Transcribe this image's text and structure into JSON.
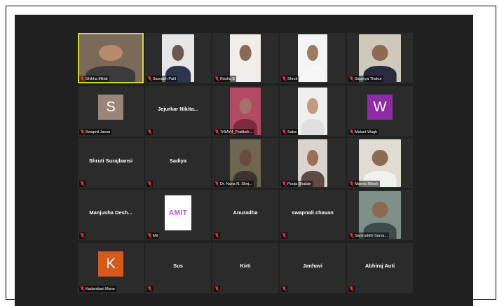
{
  "meeting": {
    "participants": [
      {
        "name": "Shikha Mittal",
        "type": "video",
        "active": true,
        "bg": "#7b6a59",
        "skin": "#b88a6b",
        "cloth": "#3b3b3b"
      },
      {
        "name": "Saurabh Patil",
        "type": "video",
        "bg": "#e6e6e6",
        "skin": "#6b5a4b",
        "cloth": "#2d3550"
      },
      {
        "name": "Rosha B",
        "type": "video",
        "bg": "#f1ede8",
        "skin": "#8a6a55",
        "cloth": "#eeeeee"
      },
      {
        "name": "Shruti",
        "type": "video",
        "bg": "#f4f4f4",
        "skin": "#a07a60",
        "cloth": "#f7f7f7"
      },
      {
        "name": "Saumya Thakur",
        "type": "video",
        "bg": "#cfc9bd",
        "skin": "#8c6b52",
        "cloth": "#2b2b40"
      },
      {
        "name": "Swapnil Jawar",
        "type": "avatar",
        "letter": "S",
        "color": "#9b8579"
      },
      {
        "name": "Jejurkar Nikita...",
        "type": "name"
      },
      {
        "name": "TrBAY4_Pratiksh...",
        "type": "video",
        "bg": "#b34a63",
        "skin": "#a5726a",
        "cloth": "#7b2b3d"
      },
      {
        "name": "Saba",
        "type": "video",
        "bg": "#efefef",
        "skin": "#c29b82",
        "cloth": "#e0e0e0"
      },
      {
        "name": "Malant Wagh",
        "type": "avatar",
        "letter": "W",
        "color": "#8e2ca3"
      },
      {
        "name": "Shruti Surajbansi",
        "type": "name"
      },
      {
        "name": "Sadiya",
        "type": "name"
      },
      {
        "name": "Dr. Nana N. Shej...",
        "type": "video",
        "bg": "#6e6651",
        "skin": "#6a4a3a",
        "cloth": "#3a3430"
      },
      {
        "name": "Pooja Bhalale",
        "type": "video",
        "bg": "#d9d4cd",
        "skin": "#9a7057",
        "cloth": "#5d4c44"
      },
      {
        "name": "Mamta Nilesh",
        "type": "video",
        "bg": "#e1dcd2",
        "skin": "#8d6a52",
        "cloth": "#f0f0f0"
      },
      {
        "name": "Manjusha Desh...",
        "type": "name"
      },
      {
        "name": "Mit",
        "type": "amit",
        "center": "AMIT"
      },
      {
        "name": "Anuradha",
        "type": "name"
      },
      {
        "name": "swapnali chavan",
        "type": "name"
      },
      {
        "name": "Samruddhi Sarsa...",
        "type": "video",
        "bg": "#7f8f8a",
        "skin": "#8a6a50",
        "cloth": "#3c4a4a"
      },
      {
        "name": "Kadambari Mane",
        "type": "avatar",
        "letter": "K",
        "color": "#d65a1e"
      },
      {
        "name": "Sus",
        "type": "name",
        "short": true
      },
      {
        "name": "Kirti",
        "type": "name",
        "short": true
      },
      {
        "name": "Janhavi",
        "type": "name",
        "short": true
      },
      {
        "name": "Abhiraj Auti",
        "type": "name",
        "short": true
      }
    ]
  }
}
